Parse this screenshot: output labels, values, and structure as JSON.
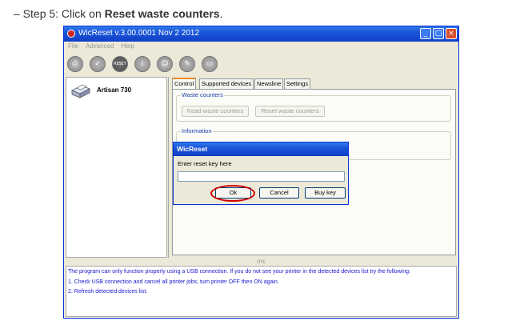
{
  "caption": {
    "prefix": "– Step 5: Click on ",
    "bold": "Reset waste counters",
    "suffix": "."
  },
  "window": {
    "title": "WicReset v.3.00.0001 Nov  2 2012",
    "minimize": "_",
    "maximize": "□",
    "close": "×"
  },
  "menu": [
    "File",
    "Advanced",
    "Help"
  ],
  "toolbar": {
    "reset_label": "RESET",
    "info_label": "i"
  },
  "printer": {
    "name": "Artisan 730"
  },
  "tabs": [
    "Control",
    "Supported devices",
    "Newsline",
    "Settings"
  ],
  "waste_counters": {
    "legend": "Waste counters",
    "read_button": "Read waste counters",
    "reset_button": "Reset waste counters"
  },
  "information": {
    "legend": "Information"
  },
  "progress": {
    "text": "0%"
  },
  "log": [
    "The program can only function properly using a USB connection. If you do not see your printer in the detected devices list try the following:",
    "1. Check USB connection and cancel all printer jobs, turn printer OFF then ON again.",
    "2. Refresh detected devices list."
  ],
  "dialog": {
    "title": "WicReset",
    "prompt": "Enter reset key here",
    "input_value": "",
    "ok": "Ok",
    "cancel": "Cancel",
    "buy": "Buy key"
  },
  "colors": {
    "titlebar": "#0F3FC7",
    "highlight": "#D00000",
    "log_text": "#1717D0"
  }
}
